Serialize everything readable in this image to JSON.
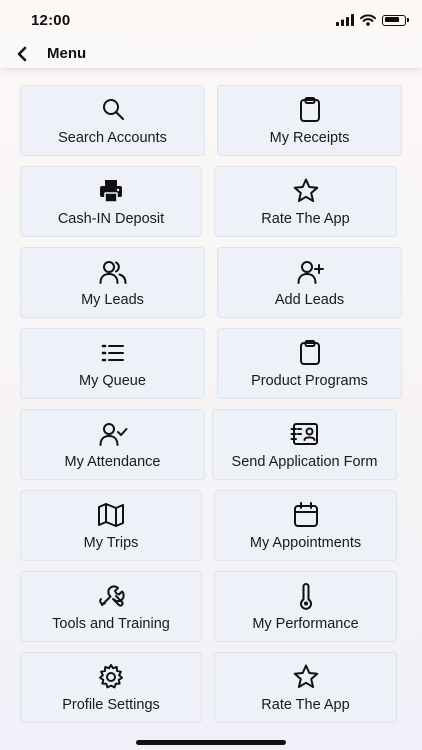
{
  "status": {
    "time": "12:00"
  },
  "header": {
    "title": "Menu"
  },
  "tiles": [
    {
      "label": "Search Accounts",
      "icon": "search-icon"
    },
    {
      "label": "My Receipts",
      "icon": "clipboard-icon"
    },
    {
      "label": "Cash-IN Deposit",
      "icon": "printer-icon"
    },
    {
      "label": "Rate The App",
      "icon": "star-icon"
    },
    {
      "label": "My Leads",
      "icon": "users-icon"
    },
    {
      "label": "Add Leads",
      "icon": "user-plus-icon"
    },
    {
      "label": "My Queue",
      "icon": "list-icon"
    },
    {
      "label": "Product Programs",
      "icon": "clipboard-icon"
    },
    {
      "label": "My Attendance",
      "icon": "user-check-icon"
    },
    {
      "label": "Send Application Form",
      "icon": "contact-card-icon"
    },
    {
      "label": "My Trips",
      "icon": "map-icon"
    },
    {
      "label": "My Appointments",
      "icon": "calendar-icon"
    },
    {
      "label": "Tools and Training",
      "icon": "wrench-icon"
    },
    {
      "label": "My Performance",
      "icon": "thermometer-icon"
    },
    {
      "label": "Profile Settings",
      "icon": "gear-icon"
    },
    {
      "label": "Rate The App",
      "icon": "star-icon"
    }
  ]
}
